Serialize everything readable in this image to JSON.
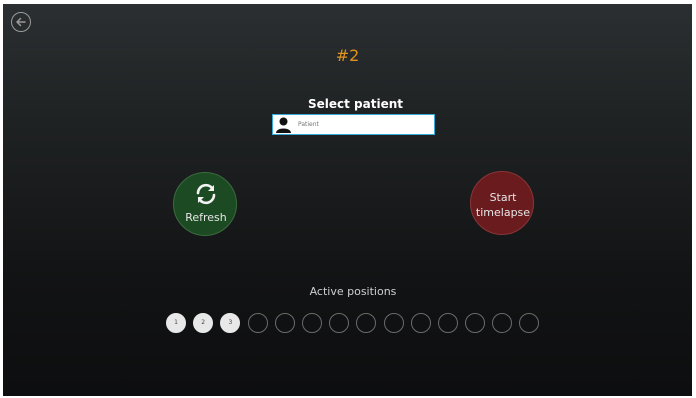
{
  "title": "#2",
  "select_patient": {
    "label": "Select patient",
    "placeholder": "Patient",
    "value": ""
  },
  "refresh": {
    "label": "Refresh",
    "icon": "refresh-icon"
  },
  "start": {
    "label_line1": "Start",
    "label_line2": "timelapse"
  },
  "active_positions": {
    "label": "Active positions",
    "positions": [
      {
        "label": "1",
        "active": true
      },
      {
        "label": "2",
        "active": true
      },
      {
        "label": "3",
        "active": true
      },
      {
        "label": "",
        "active": false
      },
      {
        "label": "",
        "active": false
      },
      {
        "label": "",
        "active": false
      },
      {
        "label": "",
        "active": false
      },
      {
        "label": "",
        "active": false
      },
      {
        "label": "",
        "active": false
      },
      {
        "label": "",
        "active": false
      },
      {
        "label": "",
        "active": false
      },
      {
        "label": "",
        "active": false
      },
      {
        "label": "",
        "active": false
      },
      {
        "label": "",
        "active": false
      }
    ]
  },
  "colors": {
    "title": "#e0941c",
    "refresh_bg": "#1c4a22",
    "start_bg": "#6a1b1e",
    "input_border": "#38a8d8"
  }
}
